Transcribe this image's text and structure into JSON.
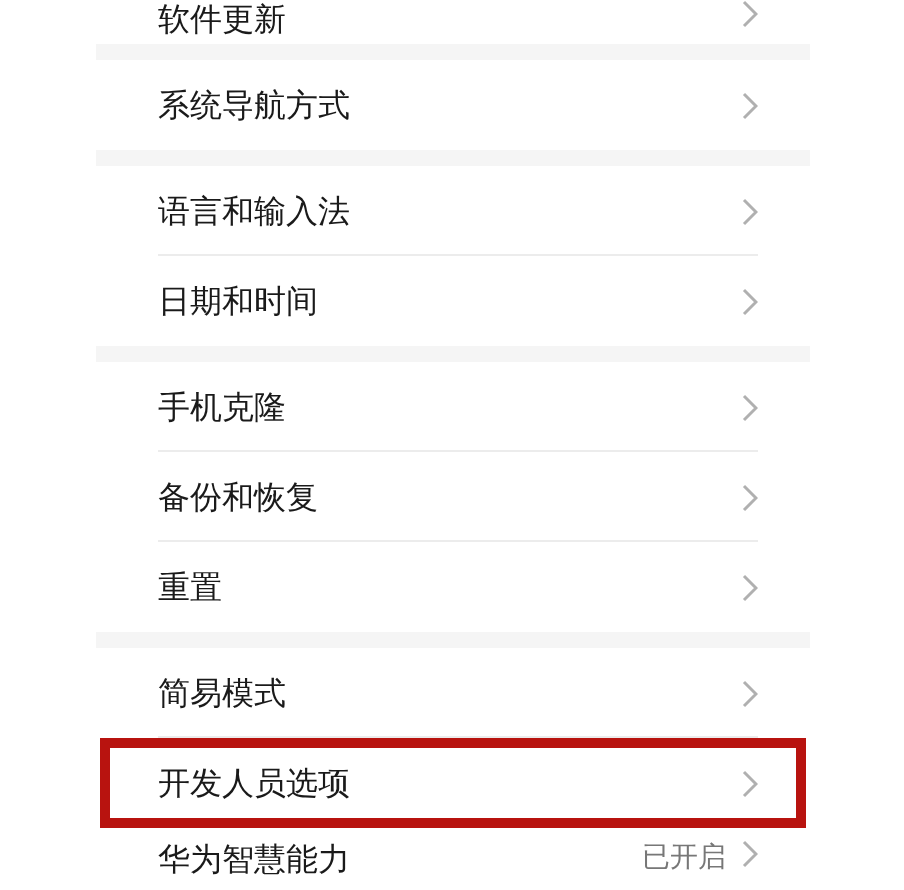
{
  "groups": [
    {
      "items": [
        {
          "label": "软件更新",
          "highlighted": false
        }
      ]
    },
    {
      "items": [
        {
          "label": "系统导航方式",
          "highlighted": false
        }
      ]
    },
    {
      "items": [
        {
          "label": "语言和输入法",
          "highlighted": false
        },
        {
          "label": "日期和时间",
          "highlighted": false
        }
      ]
    },
    {
      "items": [
        {
          "label": "手机克隆",
          "highlighted": false
        },
        {
          "label": "备份和恢复",
          "highlighted": false
        },
        {
          "label": "重置",
          "highlighted": false
        }
      ]
    },
    {
      "items": [
        {
          "label": "简易模式",
          "highlighted": false
        },
        {
          "label": "开发人员选项",
          "highlighted": true
        },
        {
          "label": "华为智慧能力",
          "value": "已开启",
          "highlighted": false
        }
      ]
    }
  ]
}
